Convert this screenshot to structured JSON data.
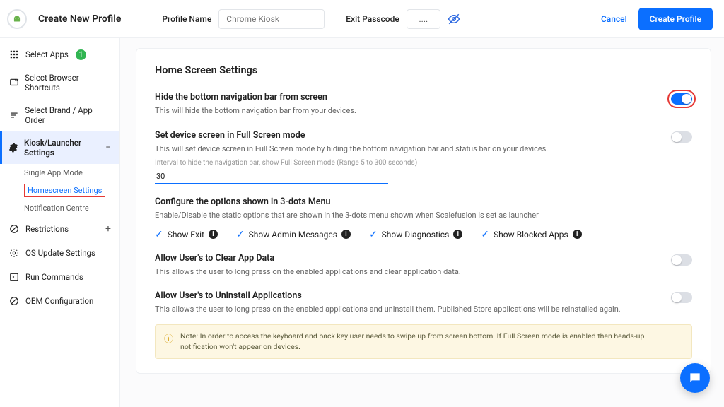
{
  "header": {
    "title": "Create New Profile",
    "profile_name_label": "Profile Name",
    "profile_name_placeholder": "Chrome Kiosk",
    "exit_passcode_label": "Exit Passcode",
    "exit_passcode_value": "....",
    "cancel": "Cancel",
    "create": "Create Profile"
  },
  "sidebar": {
    "select_apps": "Select Apps",
    "app_count": "1",
    "browser_shortcuts": "Select Browser Shortcuts",
    "brand_order": "Select Brand / App Order",
    "kiosk_launcher": "Kiosk/Launcher Settings",
    "sub": {
      "single_app": "Single App Mode",
      "homescreen": "Homescreen Settings",
      "notification": "Notification Centre"
    },
    "restrictions": "Restrictions",
    "os_update": "OS Update Settings",
    "run_commands": "Run Commands",
    "oem_config": "OEM Configuration"
  },
  "content": {
    "title": "Home Screen Settings",
    "hide_nav": {
      "title": "Hide the bottom navigation bar from screen",
      "desc": "This will hide the bottom navigation bar from your devices."
    },
    "full_screen": {
      "title": "Set device screen in Full Screen mode",
      "desc": "This will set device screen in Full Screen mode by hiding the bottom navigation bar and status bar on your devices.",
      "interval_label": "Interval to hide the navigation bar, show Full Screen mode (Range 5 to 300 seconds)",
      "interval_value": "30"
    },
    "three_dots": {
      "title": "Configure the options shown in 3-dots Menu",
      "desc": "Enable/Disable the static options that are shown in the 3-dots menu shown when Scalefusion is set as launcher",
      "opts": {
        "exit": "Show Exit",
        "admin": "Show Admin Messages",
        "diag": "Show Diagnostics",
        "blocked": "Show Blocked Apps"
      }
    },
    "clear_app": {
      "title": "Allow User's to Clear App Data",
      "desc": "This allows the user to long press on the enabled applications and clear application data."
    },
    "uninstall": {
      "title": "Allow User's to Uninstall Applications",
      "desc": "This allows the user to long press on the enabled applications and uninstall them. Published Store applications will be reinstalled again."
    },
    "note": "Note: In order to access the keyboard and back key user needs to swipe up from screen bottom. If Full Screen mode is enabled then heads-up notification won't appear on devices."
  }
}
